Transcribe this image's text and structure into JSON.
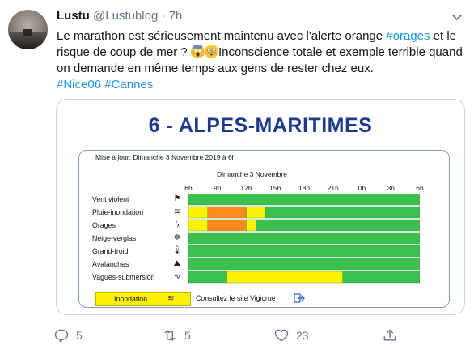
{
  "tweet": {
    "display_name": "Lustu",
    "handle": "@Lustublog",
    "separator": "·",
    "time": "7h",
    "text_before": "Le marathon est sérieusement maintenu avec l'alerte orange ",
    "tag_orages": "#orages",
    "text_mid": " et le risque de coup de mer ? ",
    "text_after": "Inconscience totale et exemple terrible quand on demande en même temps aux gens de rester chez eux.",
    "tag_nice": "#Nice06",
    "tag_cannes": "#Cannes",
    "emojis": [
      "face-screaming-in-fear",
      "flushed-face"
    ]
  },
  "card": {
    "title": "6 - ALPES-MARITIMES",
    "updated": "Mise à jour: Dimanche 3 Novembre 2019 à 6h",
    "day_label": "Dimanche 3 Novembre",
    "hours": [
      "6h",
      "9h",
      "12h",
      "15h",
      "18h",
      "21h",
      "0h",
      "3h",
      "6h"
    ],
    "rows": [
      {
        "label": "Vent violent",
        "icon": "wind-flag-icon"
      },
      {
        "label": "Pluie-inondation",
        "icon": "rain-flood-icon"
      },
      {
        "label": "Orages",
        "icon": "lightning-icon"
      },
      {
        "label": "Neige-verglas",
        "icon": "snowflake-icon"
      },
      {
        "label": "Grand-froid",
        "icon": "thermometer-icon"
      },
      {
        "label": "Avalanches",
        "icon": "avalanche-icon"
      },
      {
        "label": "Vagues-submersion",
        "icon": "wave-icon"
      }
    ],
    "vigilance_hours": [
      6,
      30
    ],
    "vigilance_segments": [
      [
        {
          "from": 6,
          "to": 30,
          "level": "green"
        }
      ],
      [
        {
          "from": 6,
          "to": 8,
          "level": "yellow"
        },
        {
          "from": 8,
          "to": 12,
          "level": "orange"
        },
        {
          "from": 12,
          "to": 14,
          "level": "yellow"
        },
        {
          "from": 14,
          "to": 30,
          "level": "green"
        }
      ],
      [
        {
          "from": 6,
          "to": 8,
          "level": "yellow"
        },
        {
          "from": 8,
          "to": 12,
          "level": "orange"
        },
        {
          "from": 12,
          "to": 13,
          "level": "yellow"
        },
        {
          "from": 13,
          "to": 30,
          "level": "green"
        }
      ],
      [
        {
          "from": 6,
          "to": 30,
          "level": "green"
        }
      ],
      [
        {
          "from": 6,
          "to": 30,
          "level": "green"
        }
      ],
      [
        {
          "from": 6,
          "to": 30,
          "level": "green"
        }
      ],
      [
        {
          "from": 6,
          "to": 10,
          "level": "green"
        },
        {
          "from": 10,
          "to": 22,
          "level": "yellow"
        },
        {
          "from": 22,
          "to": 30,
          "level": "green"
        }
      ]
    ],
    "level_colors": {
      "green": "#3bbf4f",
      "yellow": "#fff200",
      "orange": "#ff8a1c"
    },
    "legend_label": "Inondation",
    "vigicrue_text": "Consultez le site Vigicrue"
  },
  "actions": {
    "reply_count": "5",
    "retweet_count": "5",
    "like_count": "23"
  },
  "colors": {
    "link": "#1b95e0",
    "muted": "#657786",
    "title_blue": "#1d3a8a"
  }
}
